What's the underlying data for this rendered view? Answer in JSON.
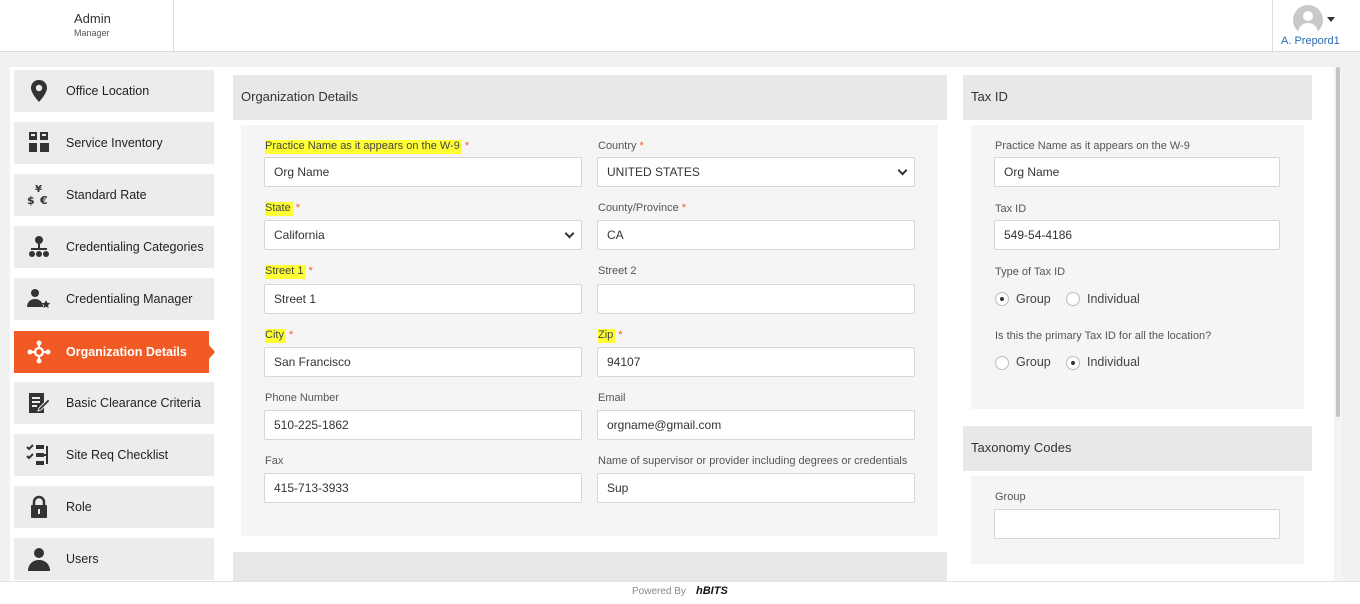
{
  "header": {
    "title": "Admin",
    "subtitle": "Manager",
    "user_name": "A. Prepord1"
  },
  "sidebar": {
    "items": [
      {
        "label": "Office Location",
        "icon": "map-pin-icon"
      },
      {
        "label": "Service Inventory",
        "icon": "inventory-icon"
      },
      {
        "label": "Standard Rate",
        "icon": "currency-icon"
      },
      {
        "label": "Credentialing Categories",
        "icon": "hierarchy-icon"
      },
      {
        "label": "Credentialing Manager",
        "icon": "user-star-icon"
      },
      {
        "label": "Organization Details",
        "icon": "organization-icon",
        "active": true
      },
      {
        "label": "Basic Clearance Criteria",
        "icon": "edit-document-icon"
      },
      {
        "label": "Site Req Checklist",
        "icon": "checklist-icon"
      },
      {
        "label": "Role",
        "icon": "lock-icon"
      },
      {
        "label": "Users",
        "icon": "user-icon"
      }
    ]
  },
  "org": {
    "title": "Organization Details",
    "fields": {
      "practice_name_label": "Practice Name as it appears on the W-9",
      "practice_name_value": "Org Name",
      "country_label": "Country",
      "country_value": "UNITED STATES",
      "state_label": "State",
      "state_value": "California",
      "county_label": "County/Province",
      "county_value": "CA",
      "street1_label": "Street 1",
      "street1_value": "Street 1",
      "street2_label": "Street 2",
      "street2_value": "",
      "city_label": "City",
      "city_value": "San Francisco",
      "zip_label": "Zip",
      "zip_value": "94107",
      "phone_label": "Phone Number",
      "phone_value": "510-225-1862",
      "email_label": "Email",
      "email_value": "orgname@gmail.com",
      "fax_label": "Fax",
      "fax_value": "415-713-3933",
      "supervisor_label": "Name of supervisor or provider including degrees or credentials",
      "supervisor_value": "Sup"
    }
  },
  "tax": {
    "title": "Tax ID",
    "practice_name_label": "Practice Name as it appears on the W-9",
    "practice_name_value": "Org Name",
    "tax_id_label": "Tax ID",
    "tax_id_value": "549-54-4186",
    "type_label": "Type of Tax ID",
    "type_options": [
      "Group",
      "Individual"
    ],
    "type_selected": "Group",
    "primary_label": "Is this the primary Tax ID for all the location?",
    "primary_options": [
      "Group",
      "Individual"
    ],
    "primary_selected": "Individual"
  },
  "taxonomy": {
    "title": "Taxonomy Codes",
    "group_label": "Group",
    "group_value": ""
  },
  "footer": {
    "powered_by": "Powered By",
    "brand": "hBITS"
  },
  "colors": {
    "accent": "#f15a24",
    "highlight": "#ffff33",
    "link": "#2b6cb0"
  }
}
